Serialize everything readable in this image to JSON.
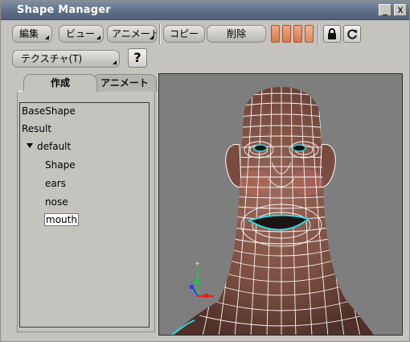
{
  "window": {
    "title": "Shape Manager",
    "minimize_glyph": "_",
    "close_glyph": "x"
  },
  "toolbar1": {
    "edit_label": "編集",
    "view_label": "ビュー",
    "anim_label": "アニメート",
    "copy_label": "コピー",
    "delete_label": "削除",
    "lock_icon": "lock-icon",
    "refresh_icon": "refresh-icon",
    "bar_color": "#e58a5e"
  },
  "toolbar2": {
    "texture_label": "テクスチャ(T)",
    "help_label": "?"
  },
  "tabs": [
    {
      "label": "作成",
      "active": true
    },
    {
      "label": "アニメート",
      "active": false
    }
  ],
  "tree": {
    "items": [
      {
        "label": "BaseShape",
        "level": 0
      },
      {
        "label": "Result",
        "level": 0
      },
      {
        "label": "default",
        "level": 0,
        "expanded": true
      },
      {
        "label": "Shape",
        "level": 1
      },
      {
        "label": "ears",
        "level": 1
      },
      {
        "label": "nose",
        "level": 1
      },
      {
        "label": "mouth",
        "level": 1,
        "selected": true
      }
    ]
  },
  "viewport": {
    "background": "#7e7e7e",
    "wire_color": "#ffffff",
    "accent_color": "#35d6e0",
    "skin_color": "#8a5a4c",
    "cheek_color": "#b4675c"
  }
}
